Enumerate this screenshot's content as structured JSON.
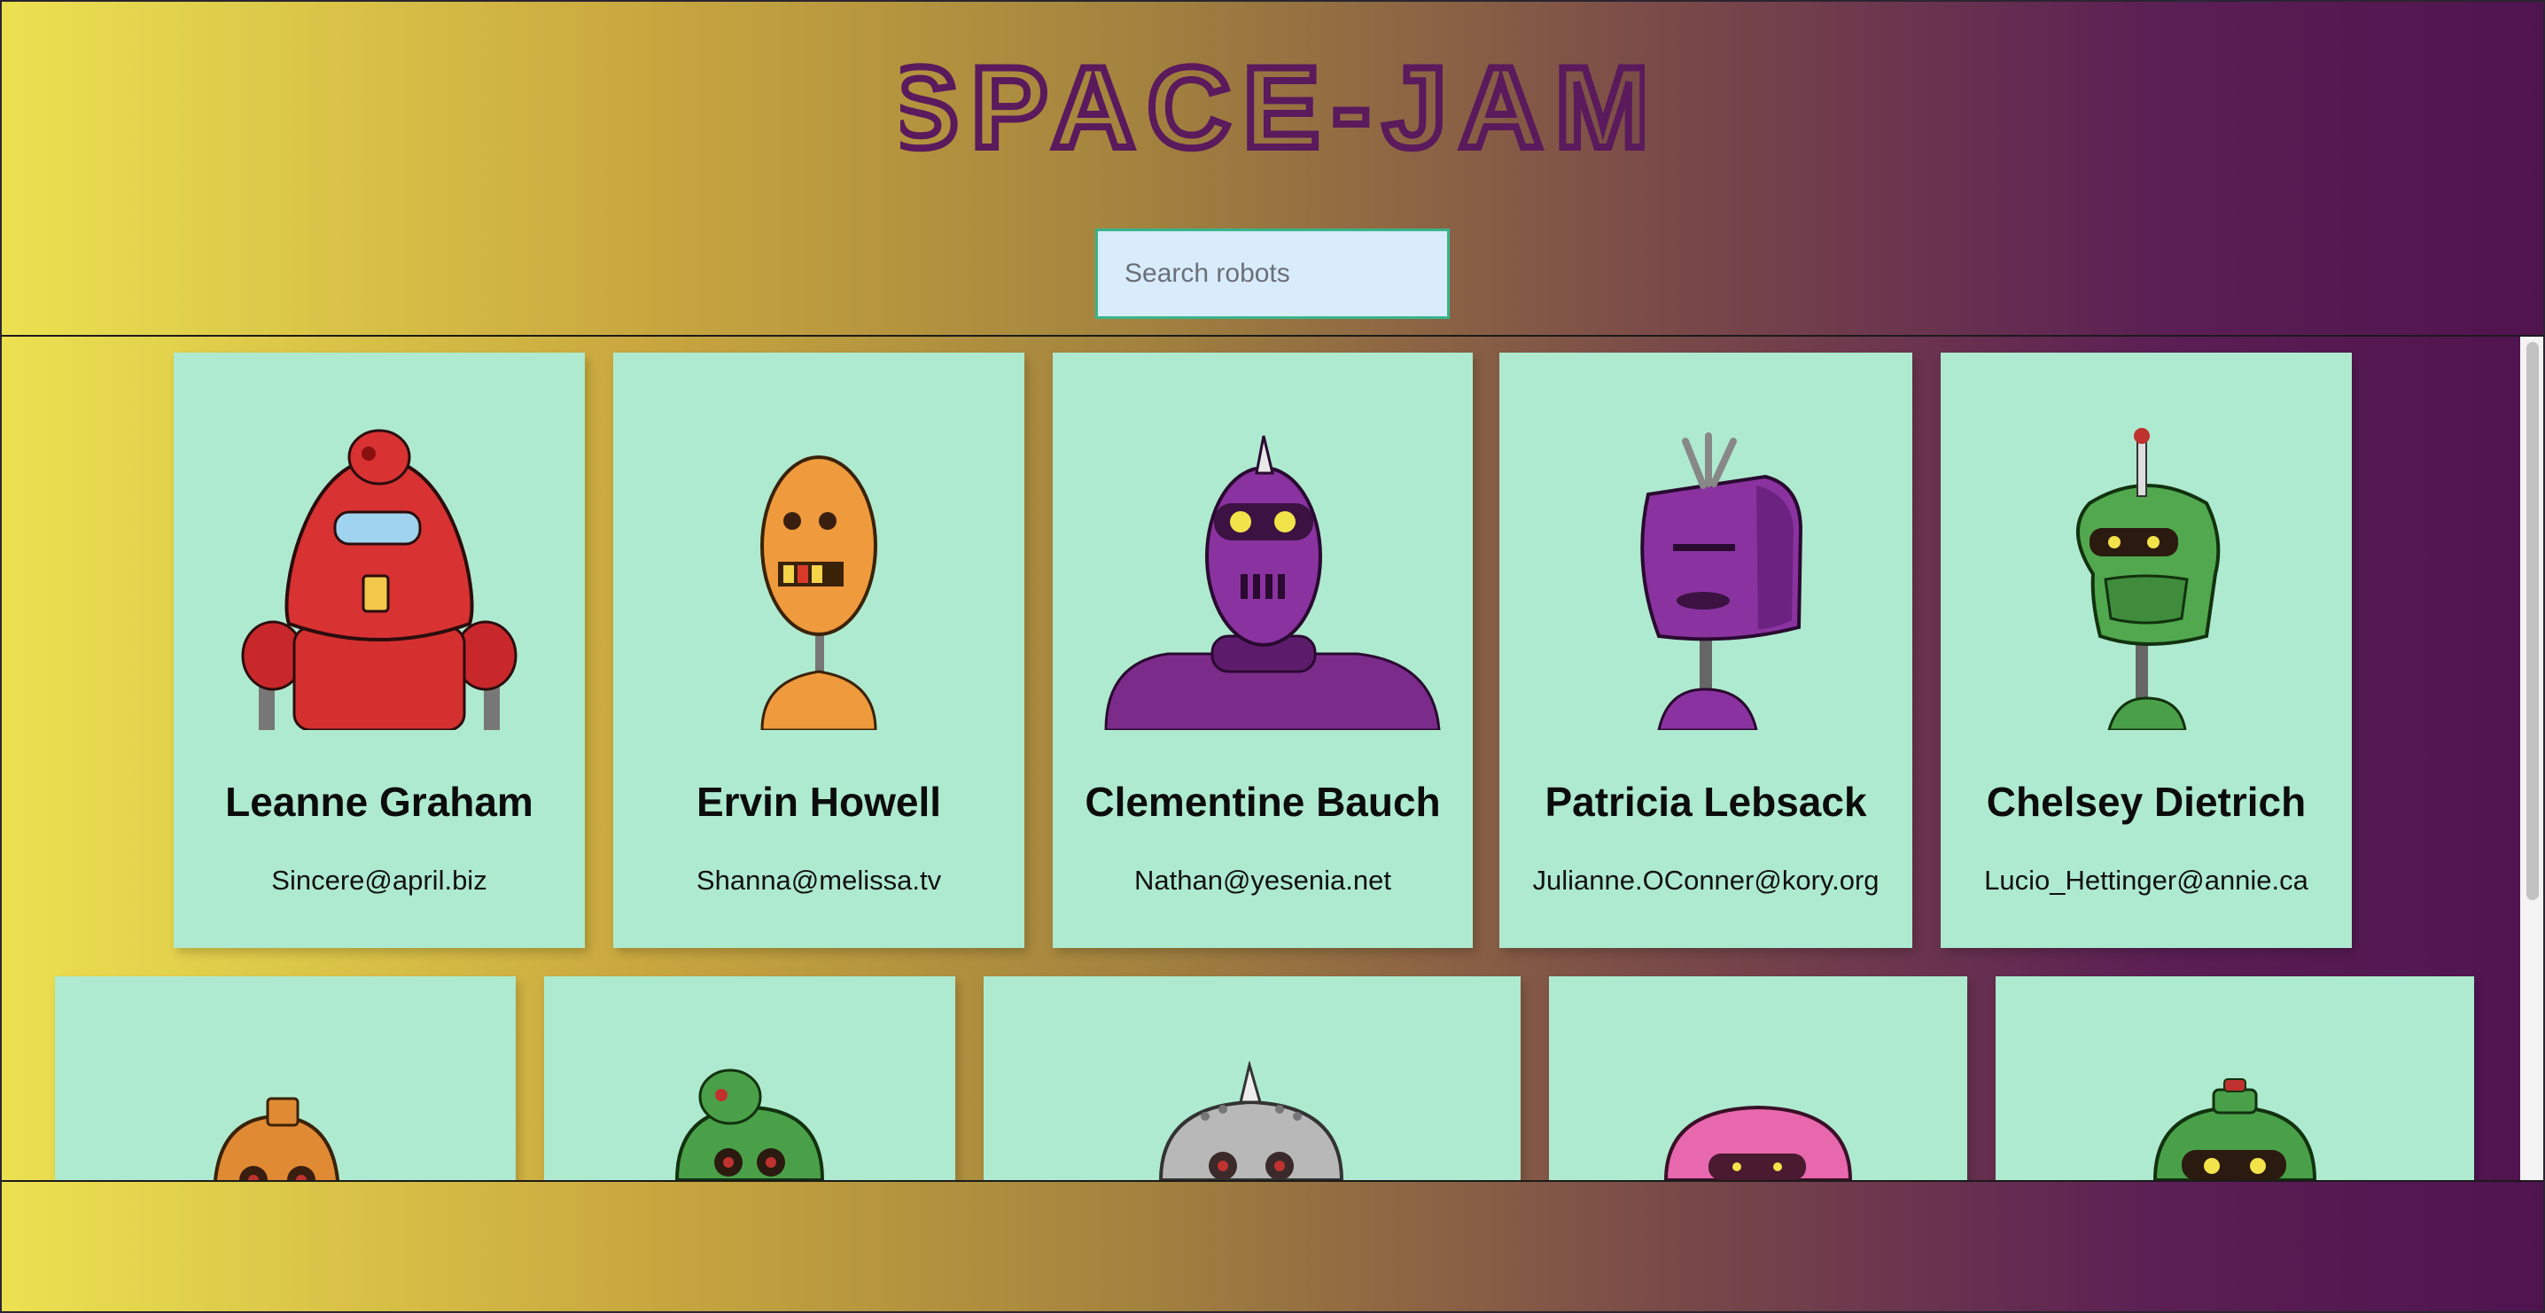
{
  "app": {
    "title": "SPACE-JAM",
    "title_color": "#5a1a5c"
  },
  "search": {
    "placeholder": "Search robots",
    "value": ""
  },
  "colors": {
    "card_bg": "#aeeacf",
    "gradient_left": "#ece151",
    "gradient_right": "#4f1350",
    "search_bg": "#d9ecfb",
    "search_border": "#38b48a"
  },
  "robots": [
    {
      "name": "Leanne Graham",
      "email": "Sincere@april.biz",
      "color": "red"
    },
    {
      "name": "Ervin Howell",
      "email": "Shanna@melissa.tv",
      "color": "orange"
    },
    {
      "name": "Clementine Bauch",
      "email": "Nathan@yesenia.net",
      "color": "purple"
    },
    {
      "name": "Patricia Lebsack",
      "email": "Julianne.OConner@kory.org",
      "color": "purple"
    },
    {
      "name": "Chelsey Dietrich",
      "email": "Lucio_Hettinger@annie.ca",
      "color": "green"
    },
    {
      "name": "",
      "email": "",
      "color": "orange"
    },
    {
      "name": "",
      "email": "",
      "color": "green"
    },
    {
      "name": "",
      "email": "",
      "color": "gray"
    },
    {
      "name": "",
      "email": "",
      "color": "pink"
    },
    {
      "name": "",
      "email": "",
      "color": "green"
    }
  ]
}
